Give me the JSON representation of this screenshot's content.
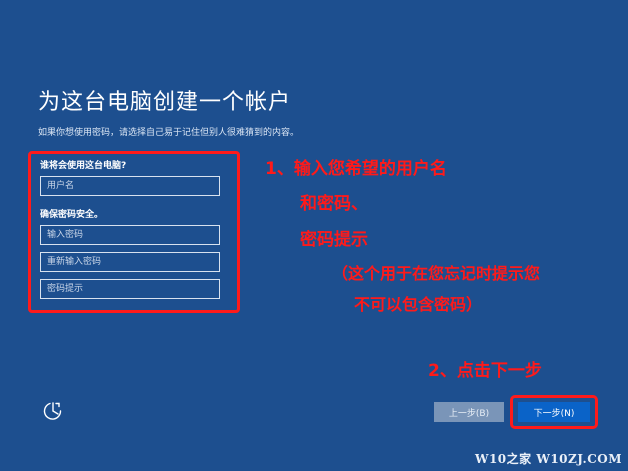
{
  "page": {
    "title": "为这台电脑创建一个帐户",
    "subtitle": "如果你想使用密码，请选择自己易于记住但别人很难猜到的内容。"
  },
  "form": {
    "username_label": "谁将会使用这台电脑?",
    "username_placeholder": "用户名",
    "password_label": "确保密码安全。",
    "password_placeholder": "输入密码",
    "confirm_placeholder": "重新输入密码",
    "hint_placeholder": "密码提示"
  },
  "annotations": {
    "step1_line1": "1、输入您希望的用户名",
    "step1_line2": "和密码、",
    "step1_line3": "密码提示",
    "step1_line4": "（这个用于在您忘记时提示您",
    "step1_line5": "不可以包含密码）",
    "step2": "2、点击下一步"
  },
  "buttons": {
    "back_label": "上一步(B)",
    "next_label": "下一步(N)"
  },
  "icons": {
    "accessibility": "accessibility-icon"
  },
  "watermark": "W10之家 W10ZJ.COM",
  "colors": {
    "background": "#1d4f8f",
    "annotation": "#ff1a1a",
    "next_button": "#0a63c8",
    "back_button": "#7a95b8"
  }
}
